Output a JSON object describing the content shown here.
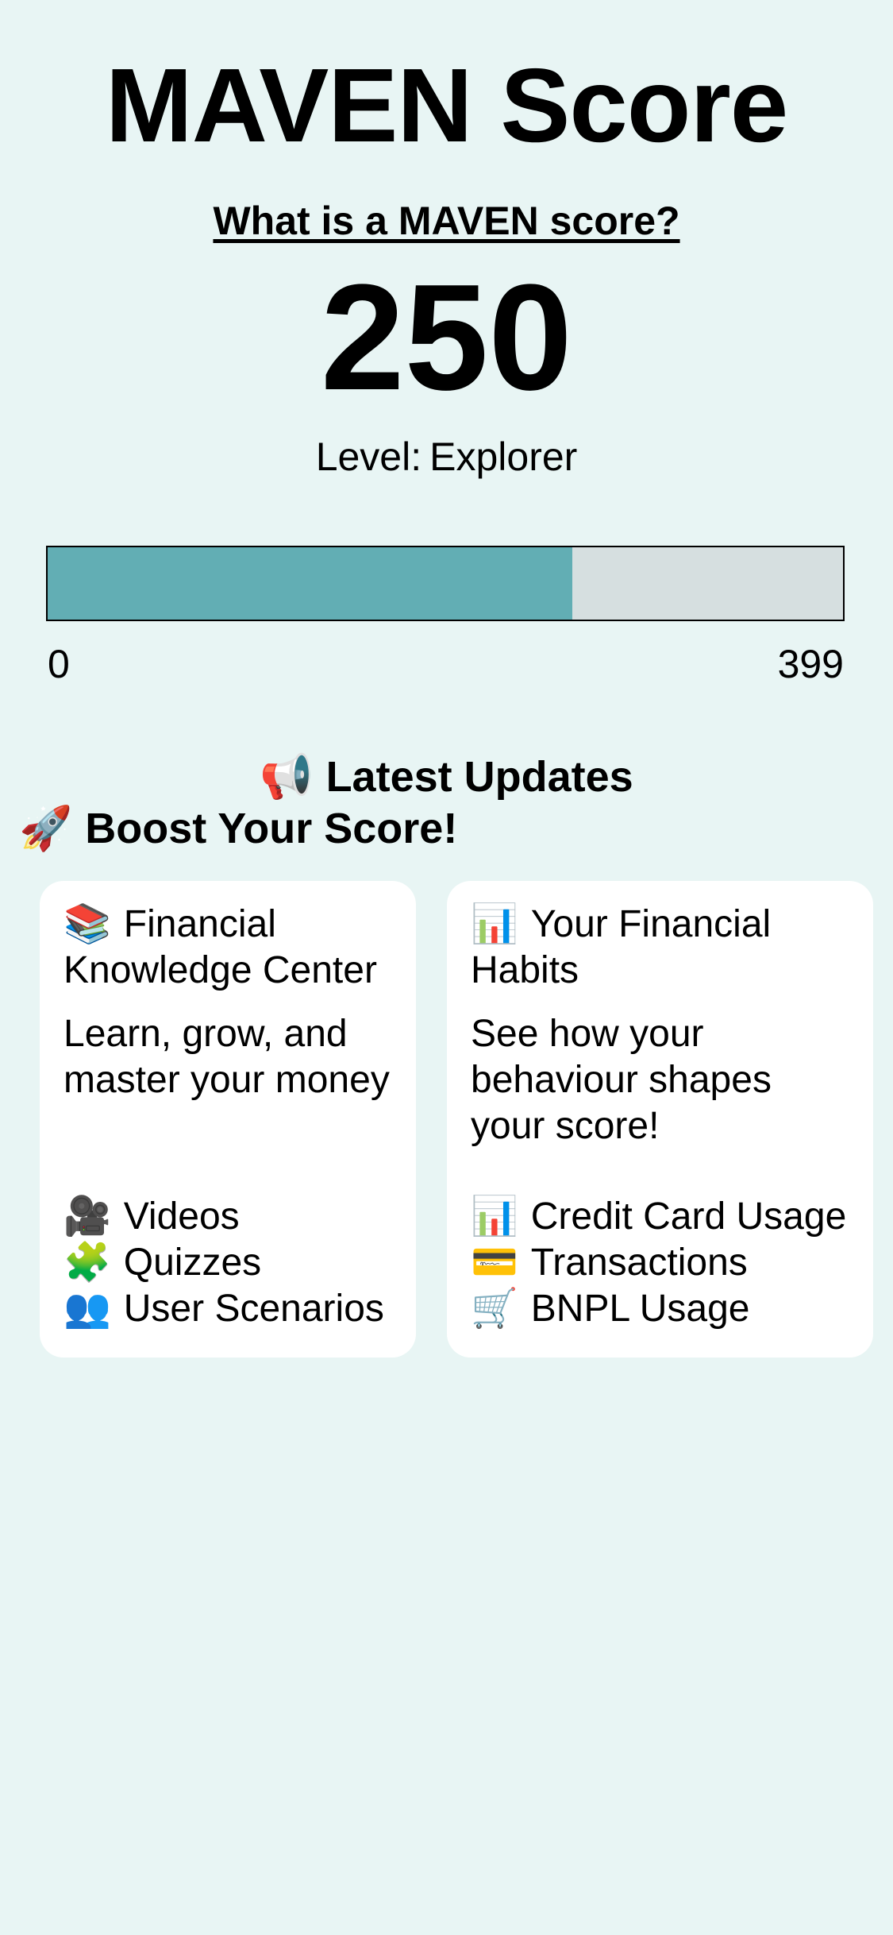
{
  "header": {
    "title": "MAVEN Score",
    "info_link": "What is a MAVEN score?"
  },
  "score": {
    "value": "250",
    "level_label": "Level:",
    "level_name": "Explorer",
    "progress": {
      "min": "0",
      "max": "399",
      "current": 250,
      "fill_fraction": 0.66,
      "fill_color": "#62aeb4",
      "track_color": "#d6dfe0"
    }
  },
  "updates": {
    "icon": "📢",
    "icon_name": "megaphone-icon",
    "title": "Latest Updates"
  },
  "boost": {
    "icon": "🚀",
    "icon_name": "rocket-icon",
    "title": "Boost Your Score!"
  },
  "cards": [
    {
      "icon": "📚",
      "icon_name": "books-icon",
      "title": "Financial Knowledge Center",
      "description": "Learn, grow, and master your money",
      "items": [
        {
          "icon": "🎥",
          "icon_name": "video-camera-icon",
          "label": "Videos"
        },
        {
          "icon": "🧩",
          "icon_name": "puzzle-icon",
          "label": "Quizzes"
        },
        {
          "icon": "👥",
          "icon_name": "users-icon",
          "label": "User Scenarios"
        }
      ]
    },
    {
      "icon": "📊",
      "icon_name": "bar-chart-icon",
      "title": "Your Financial Habits",
      "description": "See how your behaviour shapes your score!",
      "items": [
        {
          "icon": "📊",
          "icon_name": "bar-chart-icon",
          "label": "Credit Card Usage"
        },
        {
          "icon": "💳",
          "icon_name": "credit-card-icon",
          "label": "Transactions"
        },
        {
          "icon": "🛒",
          "icon_name": "shopping-cart-icon",
          "label": "BNPL Usage"
        }
      ]
    }
  ]
}
